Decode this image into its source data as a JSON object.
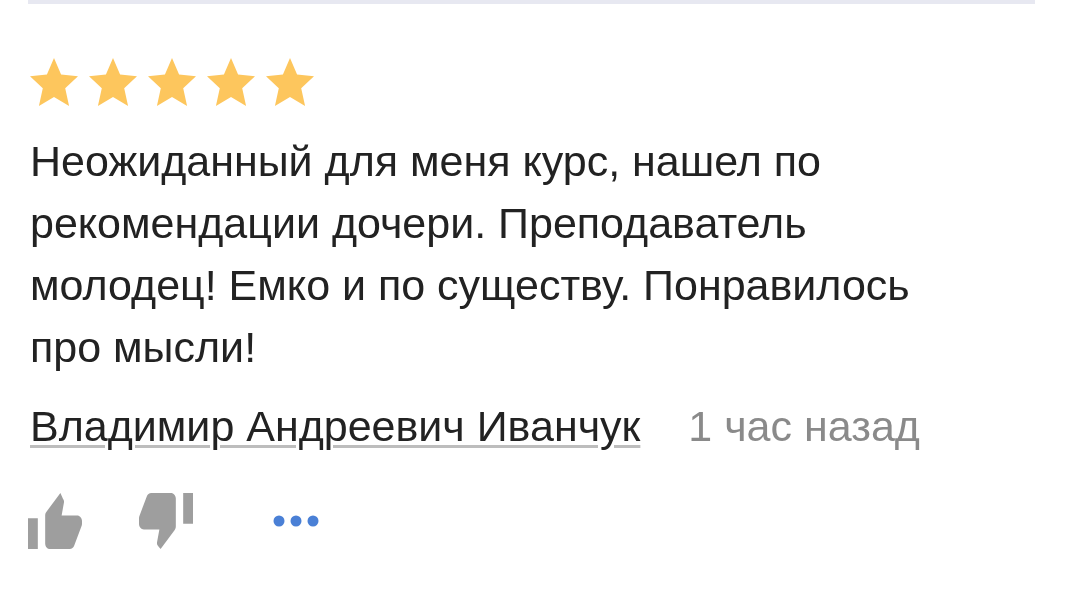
{
  "review": {
    "stars": 5,
    "text": "Неожиданный для меня курс, нашел по рекомендации дочери. Преподаватель молодец! Емко и по существу. Понравилось про мысли!",
    "author": "Владимир Андреевич Иванчук",
    "time": "1 час назад"
  }
}
